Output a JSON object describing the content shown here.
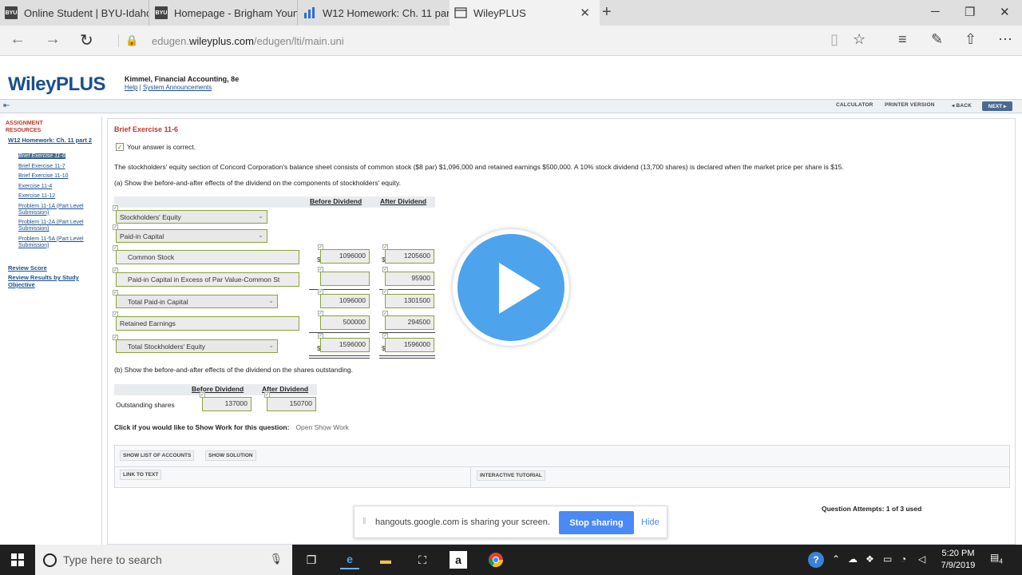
{
  "browser": {
    "tabs": [
      {
        "favicon": "BYU",
        "title": "Online Student | BYU-Idaho"
      },
      {
        "favicon": "BYU",
        "title": "Homepage - Brigham Young"
      },
      {
        "favicon": "chart",
        "title": "W12 Homework: Ch. 11 par"
      },
      {
        "favicon": "page",
        "title": "WileyPLUS"
      }
    ],
    "url_prefix": "edugen.",
    "url_domain": "wileyplus.com",
    "url_path": "/edugen/lti/main.uni"
  },
  "header": {
    "logo": "WileyPLUS",
    "book_title": "Kimmel, Financial Accounting, 8e",
    "help_link": "Help",
    "announcements_link": "System Announcements"
  },
  "toolbar": {
    "calculator": "CALCULATOR",
    "printer": "PRINTER VERSION",
    "back": "◂ BACK",
    "next": "NEXT ▸"
  },
  "sidebar": {
    "title_line1": "ASSIGNMENT",
    "title_line2": "RESOURCES",
    "homework": "W12 Homework: Ch. 11 part 2",
    "items": [
      "Brief Exercise 11-6",
      "Brief Exercise 11-7",
      "Brief Exercise 11-10",
      "Exercise 11-4",
      "Exercise 11-12",
      "Problem 11-1A (Part Level Submission)",
      "Problem 11-2A (Part Level Submission)",
      "Problem 11-5A (Part Level Submission)"
    ],
    "review_score": "Review Score",
    "review_results": "Review Results by Study Objective"
  },
  "exercise": {
    "title": "Brief Exercise 11-6",
    "correct_msg": "Your answer is correct.",
    "problem": "The stockholders' equity section of Concord Corporation's balance sheet consists of common stock ($8 par) $1,096,000 and retained earnings $500,000. A 10% stock dividend (13,700 shares) is declared when the market price per share is $15.",
    "part_a": "(a) Show the before-and-after effects of the dividend on the components of stockholders' equity.",
    "col_before": "Before Dividend",
    "col_after": "After Dividend",
    "rows": {
      "se": "Stockholders' Equity",
      "pic": "Paid-in Capital",
      "cs": "Common Stock",
      "cs_before": "1096000",
      "cs_after": "1205600",
      "apic": "Paid-in Capital in Excess of Par Value-Common St",
      "apic_before": "",
      "apic_after": "95900",
      "tpic": "Total Paid-in Capital",
      "tpic_before": "1096000",
      "tpic_after": "1301500",
      "re": "Retained Earnings",
      "re_before": "500000",
      "re_after": "294500",
      "tse": "Total Stockholders' Equity",
      "tse_before": "1596000",
      "tse_after": "1596000"
    },
    "part_b": "(b) Show the before-and-after effects of the dividend on the shares outstanding.",
    "shares_label": "Outstanding shares",
    "shares_before": "137000",
    "shares_after": "150700",
    "show_work": "Click if you would like to Show Work for this question:",
    "show_work_link": "Open Show Work",
    "btn_accounts": "SHOW LIST OF ACCOUNTS",
    "btn_solution": "SHOW SOLUTION",
    "btn_link": "LINK TO TEXT",
    "btn_tutorial": "INTERACTIVE TUTORIAL",
    "attempts": "Question Attempts: 1 of 3 used"
  },
  "sharebar": {
    "text": "hangouts.google.com is sharing your screen.",
    "stop": "Stop sharing",
    "hide": "Hide"
  },
  "taskbar": {
    "search_placeholder": "Type here to search",
    "time": "5:20 PM",
    "date": "7/9/2019",
    "notifications": "4"
  }
}
